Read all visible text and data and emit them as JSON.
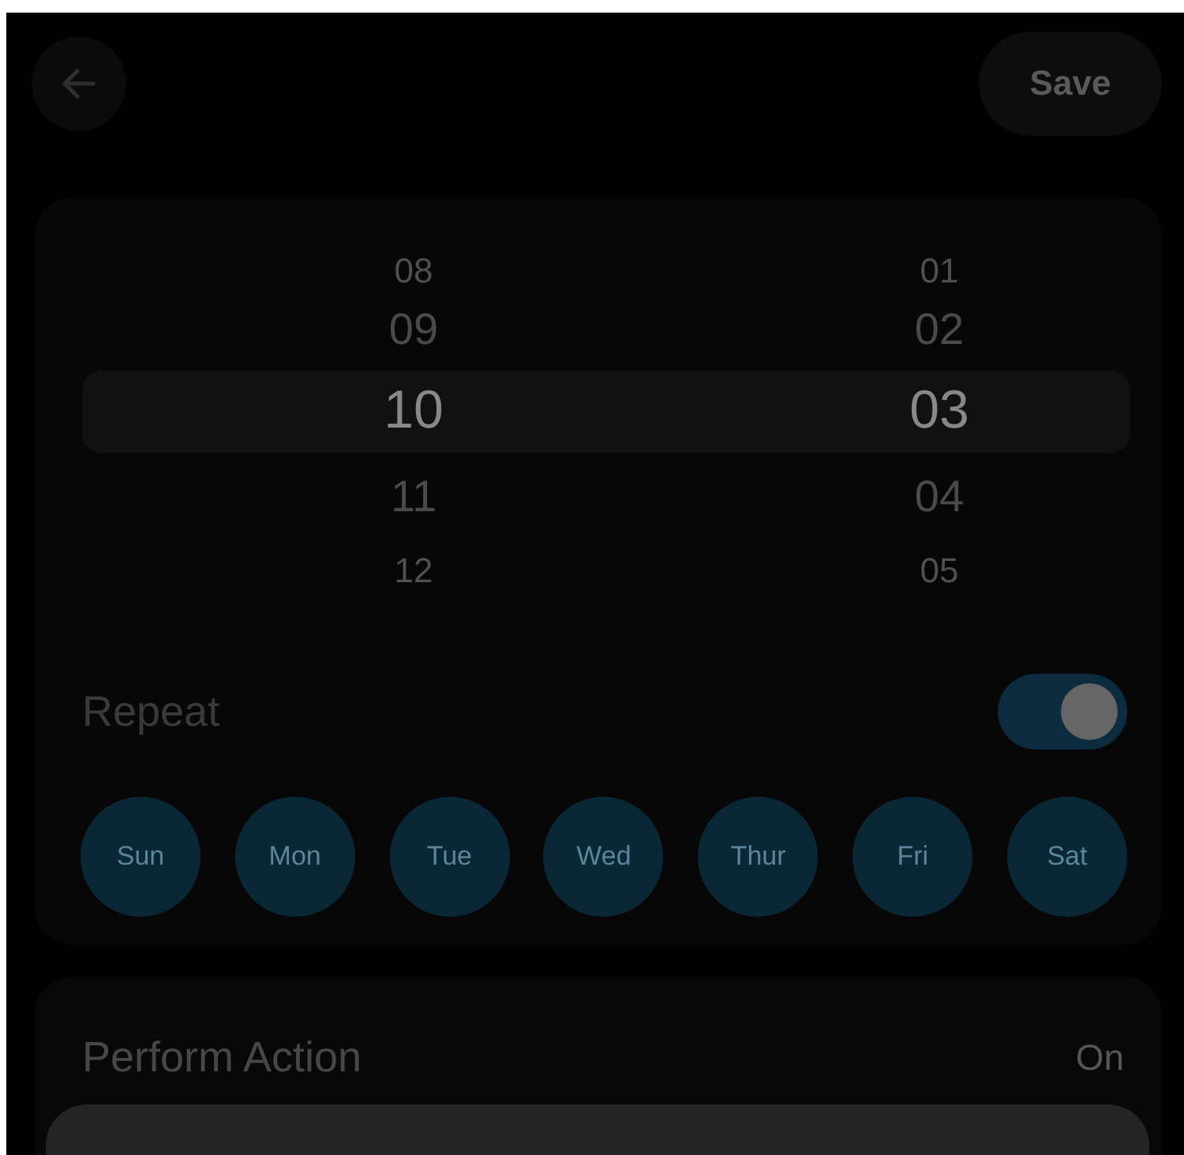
{
  "header": {
    "save_label": "Save"
  },
  "picker": {
    "columns": [
      {
        "items": [
          {
            "label": "08",
            "selected": false
          },
          {
            "label": "09",
            "selected": false
          },
          {
            "label": "10",
            "selected": true
          },
          {
            "label": "11",
            "selected": false
          },
          {
            "label": "12",
            "selected": false
          }
        ]
      },
      {
        "items": [
          {
            "label": "01",
            "selected": false
          },
          {
            "label": "02",
            "selected": false
          },
          {
            "label": "03",
            "selected": true
          },
          {
            "label": "04",
            "selected": false
          },
          {
            "label": "05",
            "selected": false
          }
        ]
      }
    ]
  },
  "repeat": {
    "label": "Repeat",
    "on": true
  },
  "days": [
    {
      "label": "Sun",
      "selected": true
    },
    {
      "label": "Mon",
      "selected": true
    },
    {
      "label": "Tue",
      "selected": true
    },
    {
      "label": "Wed",
      "selected": true
    },
    {
      "label": "Thur",
      "selected": true
    },
    {
      "label": "Fri",
      "selected": true
    },
    {
      "label": "Sat",
      "selected": true
    }
  ],
  "action": {
    "label": "Perform Action",
    "value": "On"
  }
}
